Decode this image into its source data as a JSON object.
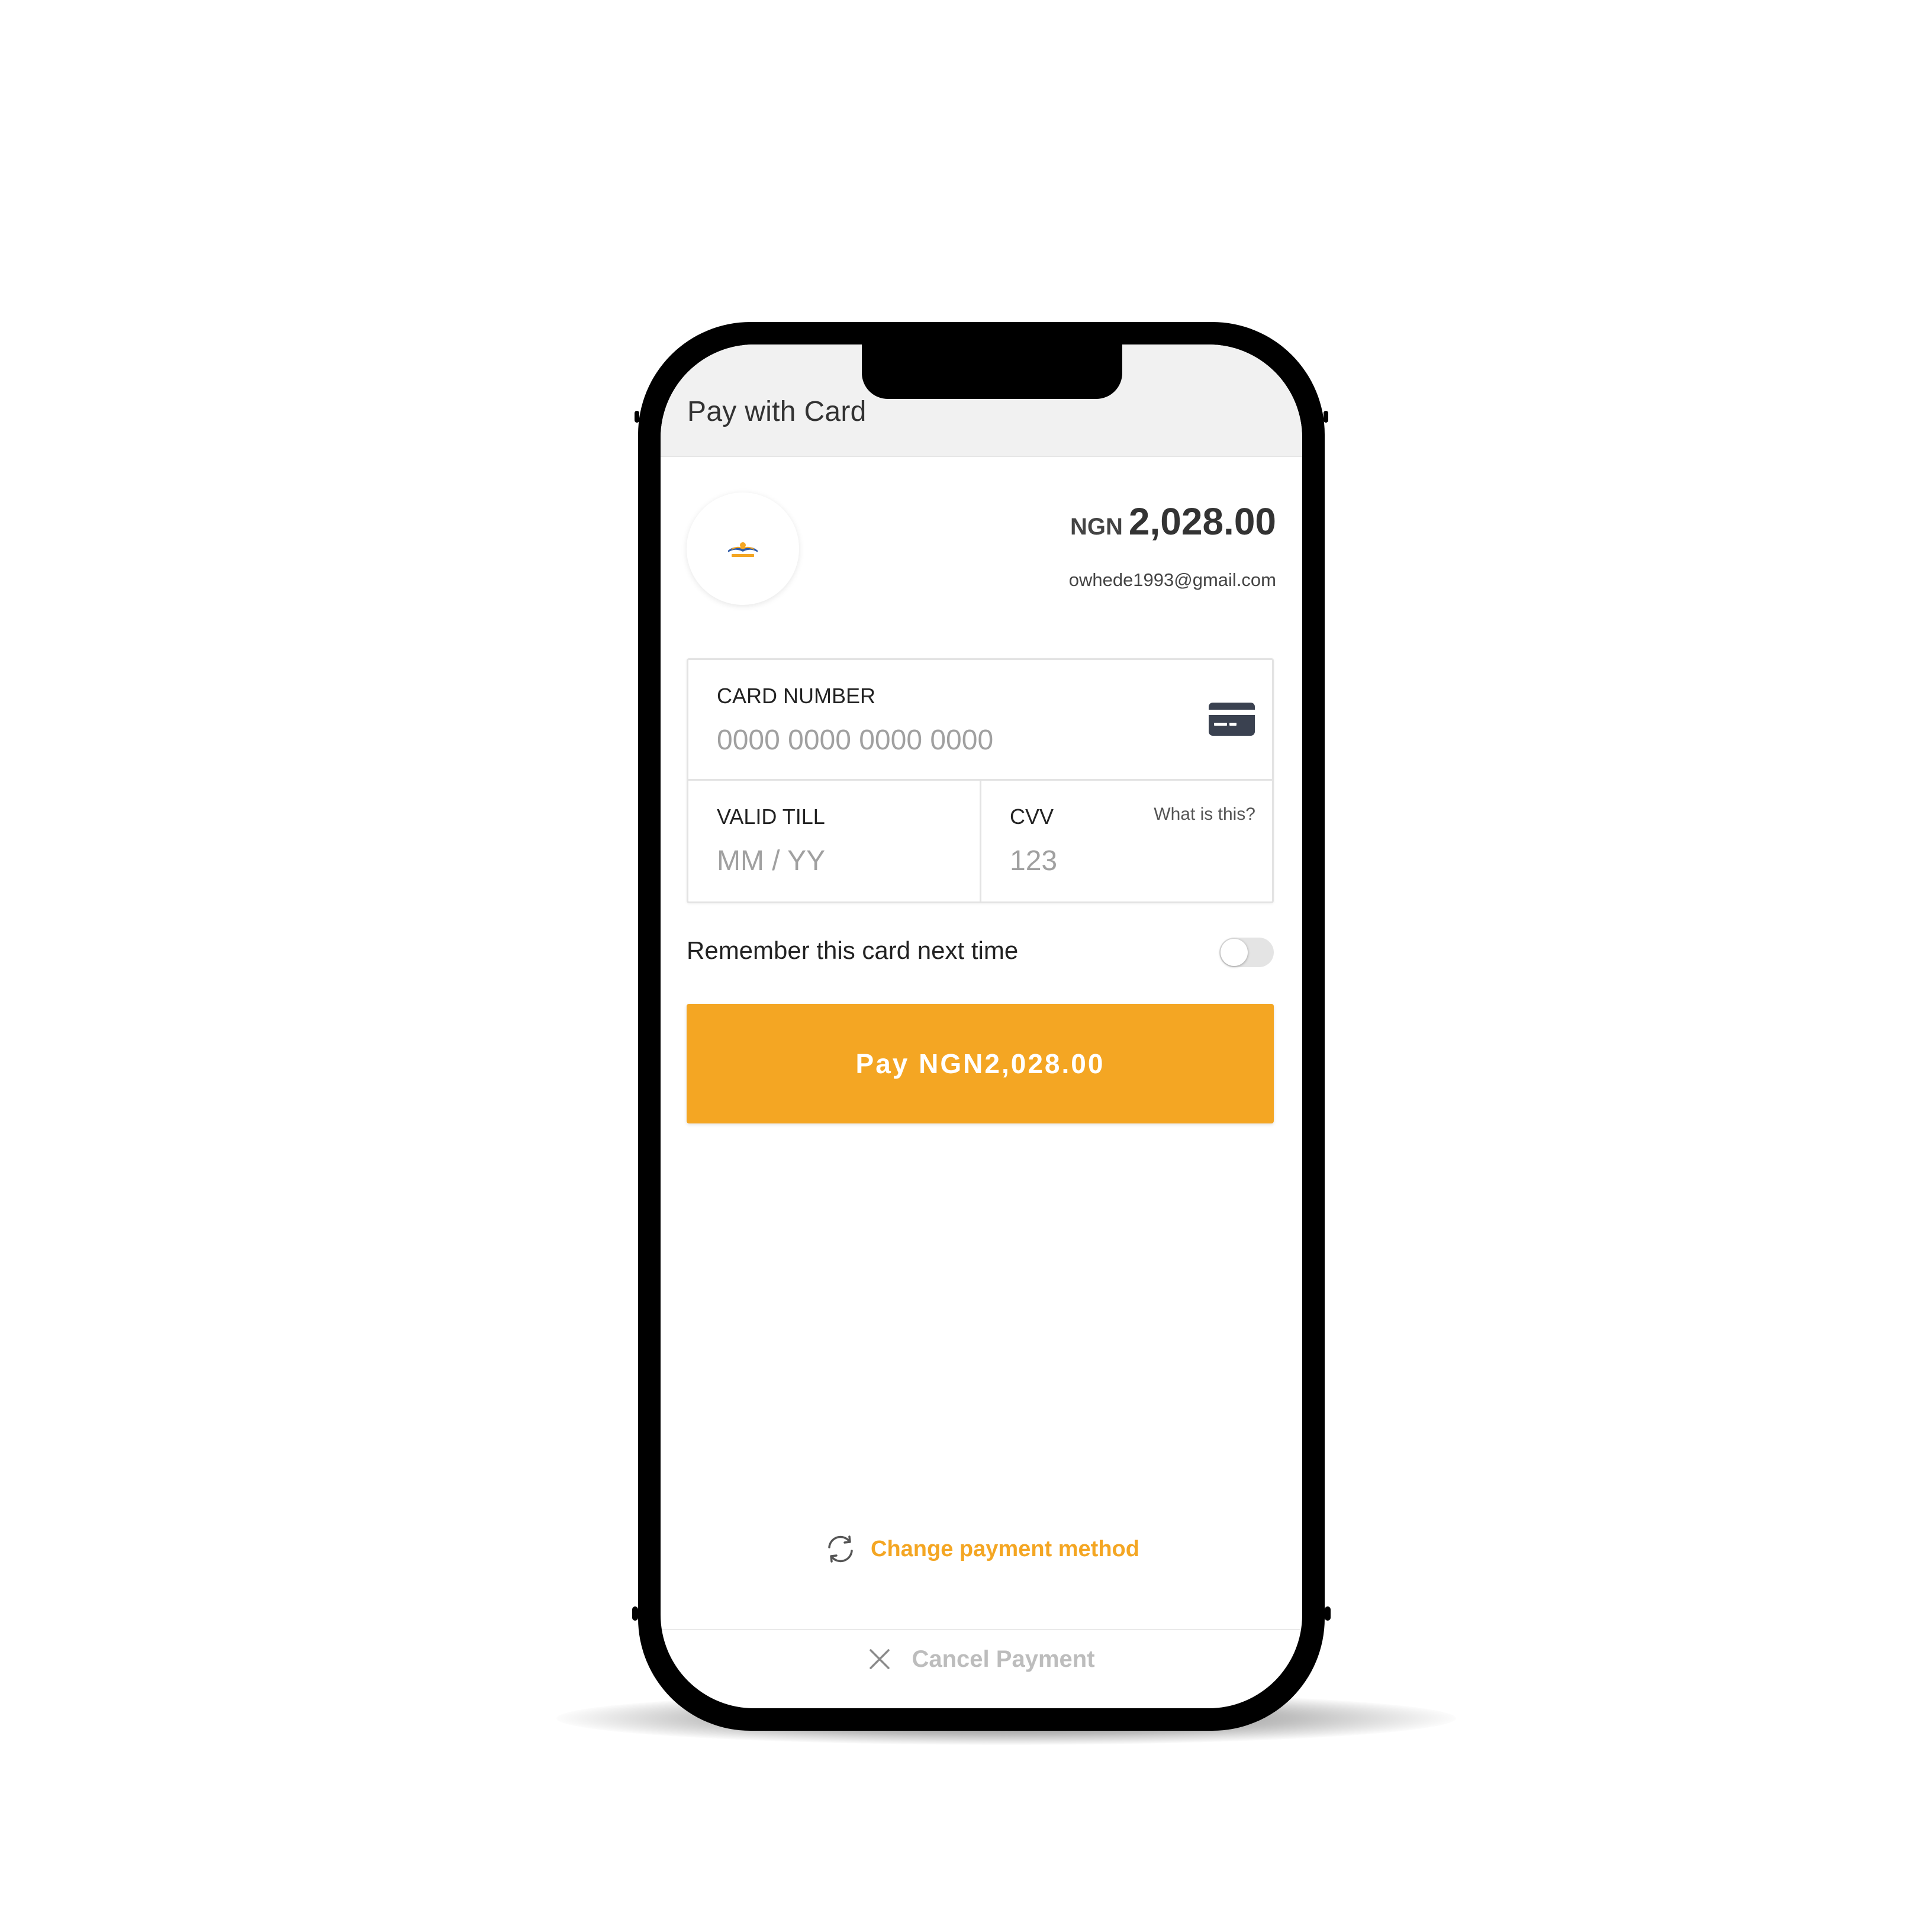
{
  "header": {
    "title": "Pay with Card"
  },
  "merchant": {
    "logo_icon": "merchant-logo-icon",
    "currency": "NGN",
    "amount": "2,028.00",
    "email": "owhede1993@gmail.com"
  },
  "form": {
    "card_number": {
      "label": "CARD NUMBER",
      "placeholder": "0000 0000 0000 0000",
      "value": "",
      "icon": "credit-card-icon"
    },
    "valid_till": {
      "label": "VALID TILL",
      "placeholder": "MM / YY",
      "value": ""
    },
    "cvv": {
      "label": "CVV",
      "placeholder": "123",
      "value": "",
      "help_link": "What is this?"
    }
  },
  "remember": {
    "label": "Remember this card next time",
    "enabled": false
  },
  "pay_button": {
    "label": "Pay NGN2,028.00"
  },
  "change_method": {
    "label": "Change payment method",
    "icon": "refresh-icon"
  },
  "cancel": {
    "label": "Cancel Payment",
    "icon": "close-icon"
  },
  "colors": {
    "accent": "#f4a623",
    "header_bg": "#f1f1f1",
    "muted_text": "#bdbdbd"
  }
}
